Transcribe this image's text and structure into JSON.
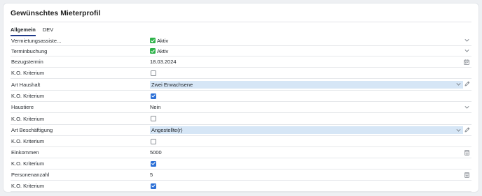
{
  "card": {
    "title": "Gewünschtes Mieterprofil"
  },
  "tabs": [
    {
      "label": "Allgemein",
      "active": true
    },
    {
      "label": "DEV",
      "active": false
    }
  ],
  "rows": [
    {
      "label": "Vermietungsassiste...",
      "value": "Aktiv",
      "kind": "status",
      "icon": "chevron-down-icon"
    },
    {
      "label": "Terminbuchung",
      "value": "Aktiv",
      "kind": "status",
      "icon": "chevron-down-icon"
    },
    {
      "label": "Bezugstermin",
      "value": "18.03.2024",
      "kind": "date",
      "icon": "calendar-icon"
    },
    {
      "label": "K.O. Kriterium",
      "checked": false,
      "kind": "checkbox"
    },
    {
      "label": "Art Haushalt",
      "value": "Zwei Erwachsene",
      "kind": "select",
      "icon": "pencil-icon"
    },
    {
      "label": "K.O. Kriterium",
      "checked": true,
      "kind": "checkbox"
    },
    {
      "label": "Haustiere",
      "value": "Nein",
      "kind": "dropdown",
      "icon": "chevron-down-icon"
    },
    {
      "label": "K.O. Kriterium",
      "checked": false,
      "kind": "checkbox"
    },
    {
      "label": "Art Beschäftigung",
      "value": "Angestellte(r)",
      "kind": "select",
      "icon": "pencil-icon"
    },
    {
      "label": "K.O. Kriterium",
      "checked": false,
      "kind": "checkbox"
    },
    {
      "label": "Einkommen",
      "value": "5000",
      "kind": "number",
      "icon": "calculator-icon"
    },
    {
      "label": "K.O. Kriterium",
      "checked": true,
      "kind": "checkbox"
    },
    {
      "label": "Personenanzahl",
      "value": "5",
      "kind": "number",
      "icon": "calculator-icon"
    },
    {
      "label": "K.O. Kriterium",
      "checked": true,
      "kind": "checkbox"
    }
  ],
  "colors": {
    "accent": "#2b6fd6",
    "success": "#2eb34a",
    "select_bg": "#d6e6f6",
    "tab_underline": "#1f3b8a"
  }
}
